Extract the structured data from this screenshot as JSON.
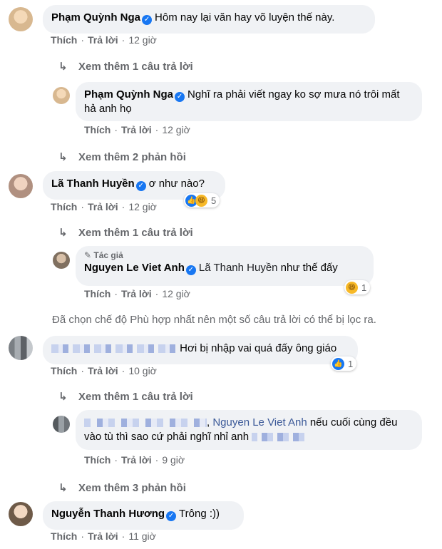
{
  "actions": {
    "like": "Thích",
    "reply": "Trả lời",
    "dot": "·"
  },
  "comments": [
    {
      "name": "Phạm Quỳnh Nga",
      "text": "Hôm nay lại văn hay võ luyện thế này.",
      "time": "12 giờ",
      "more": "Xem thêm 1 câu trả lời"
    },
    {
      "name": "Phạm Quỳnh Nga",
      "text": "Nghĩ ra phải viết ngay ko sợ mưa nó trôi mất hả anh họ",
      "time": "12 giờ",
      "more": "Xem thêm 2 phản hồi"
    },
    {
      "name": "Lã Thanh Huyền",
      "text": "ơ như nào?",
      "time": "12 giờ",
      "reaction_count": "5",
      "more": "Xem thêm 1 câu trả lời"
    },
    {
      "author_badge": "Tác giả",
      "name": "Nguyen Le Viet Anh",
      "tag": "Lã Thanh Huyền",
      "text": "như thế đấy",
      "time": "12 giờ",
      "reaction_count": "1"
    },
    {
      "text": "Hơi bị nhập vai quá đấy ông giáo",
      "time": "10 giờ",
      "reaction_count": "1",
      "more": "Xem thêm 1 câu trả lời"
    },
    {
      "tag": "Nguyen Le Viet Anh",
      "text": "nếu cuối cùng đều vào tù thì sao cứ phải nghĩ nhỉ anh",
      "time": "9 giờ",
      "more": "Xem thêm 3 phản hồi"
    },
    {
      "name": "Nguyễn Thanh Hương",
      "text": "Trông :))",
      "time": "11 giờ"
    }
  ],
  "filter_note": "Đã chọn chế độ Phù hợp nhất nên một số câu trả lời có thể bị lọc ra.",
  "colors": {
    "bubble": "#f0f2f5",
    "secondary_text": "#65676b",
    "verified": "#1877f2"
  }
}
